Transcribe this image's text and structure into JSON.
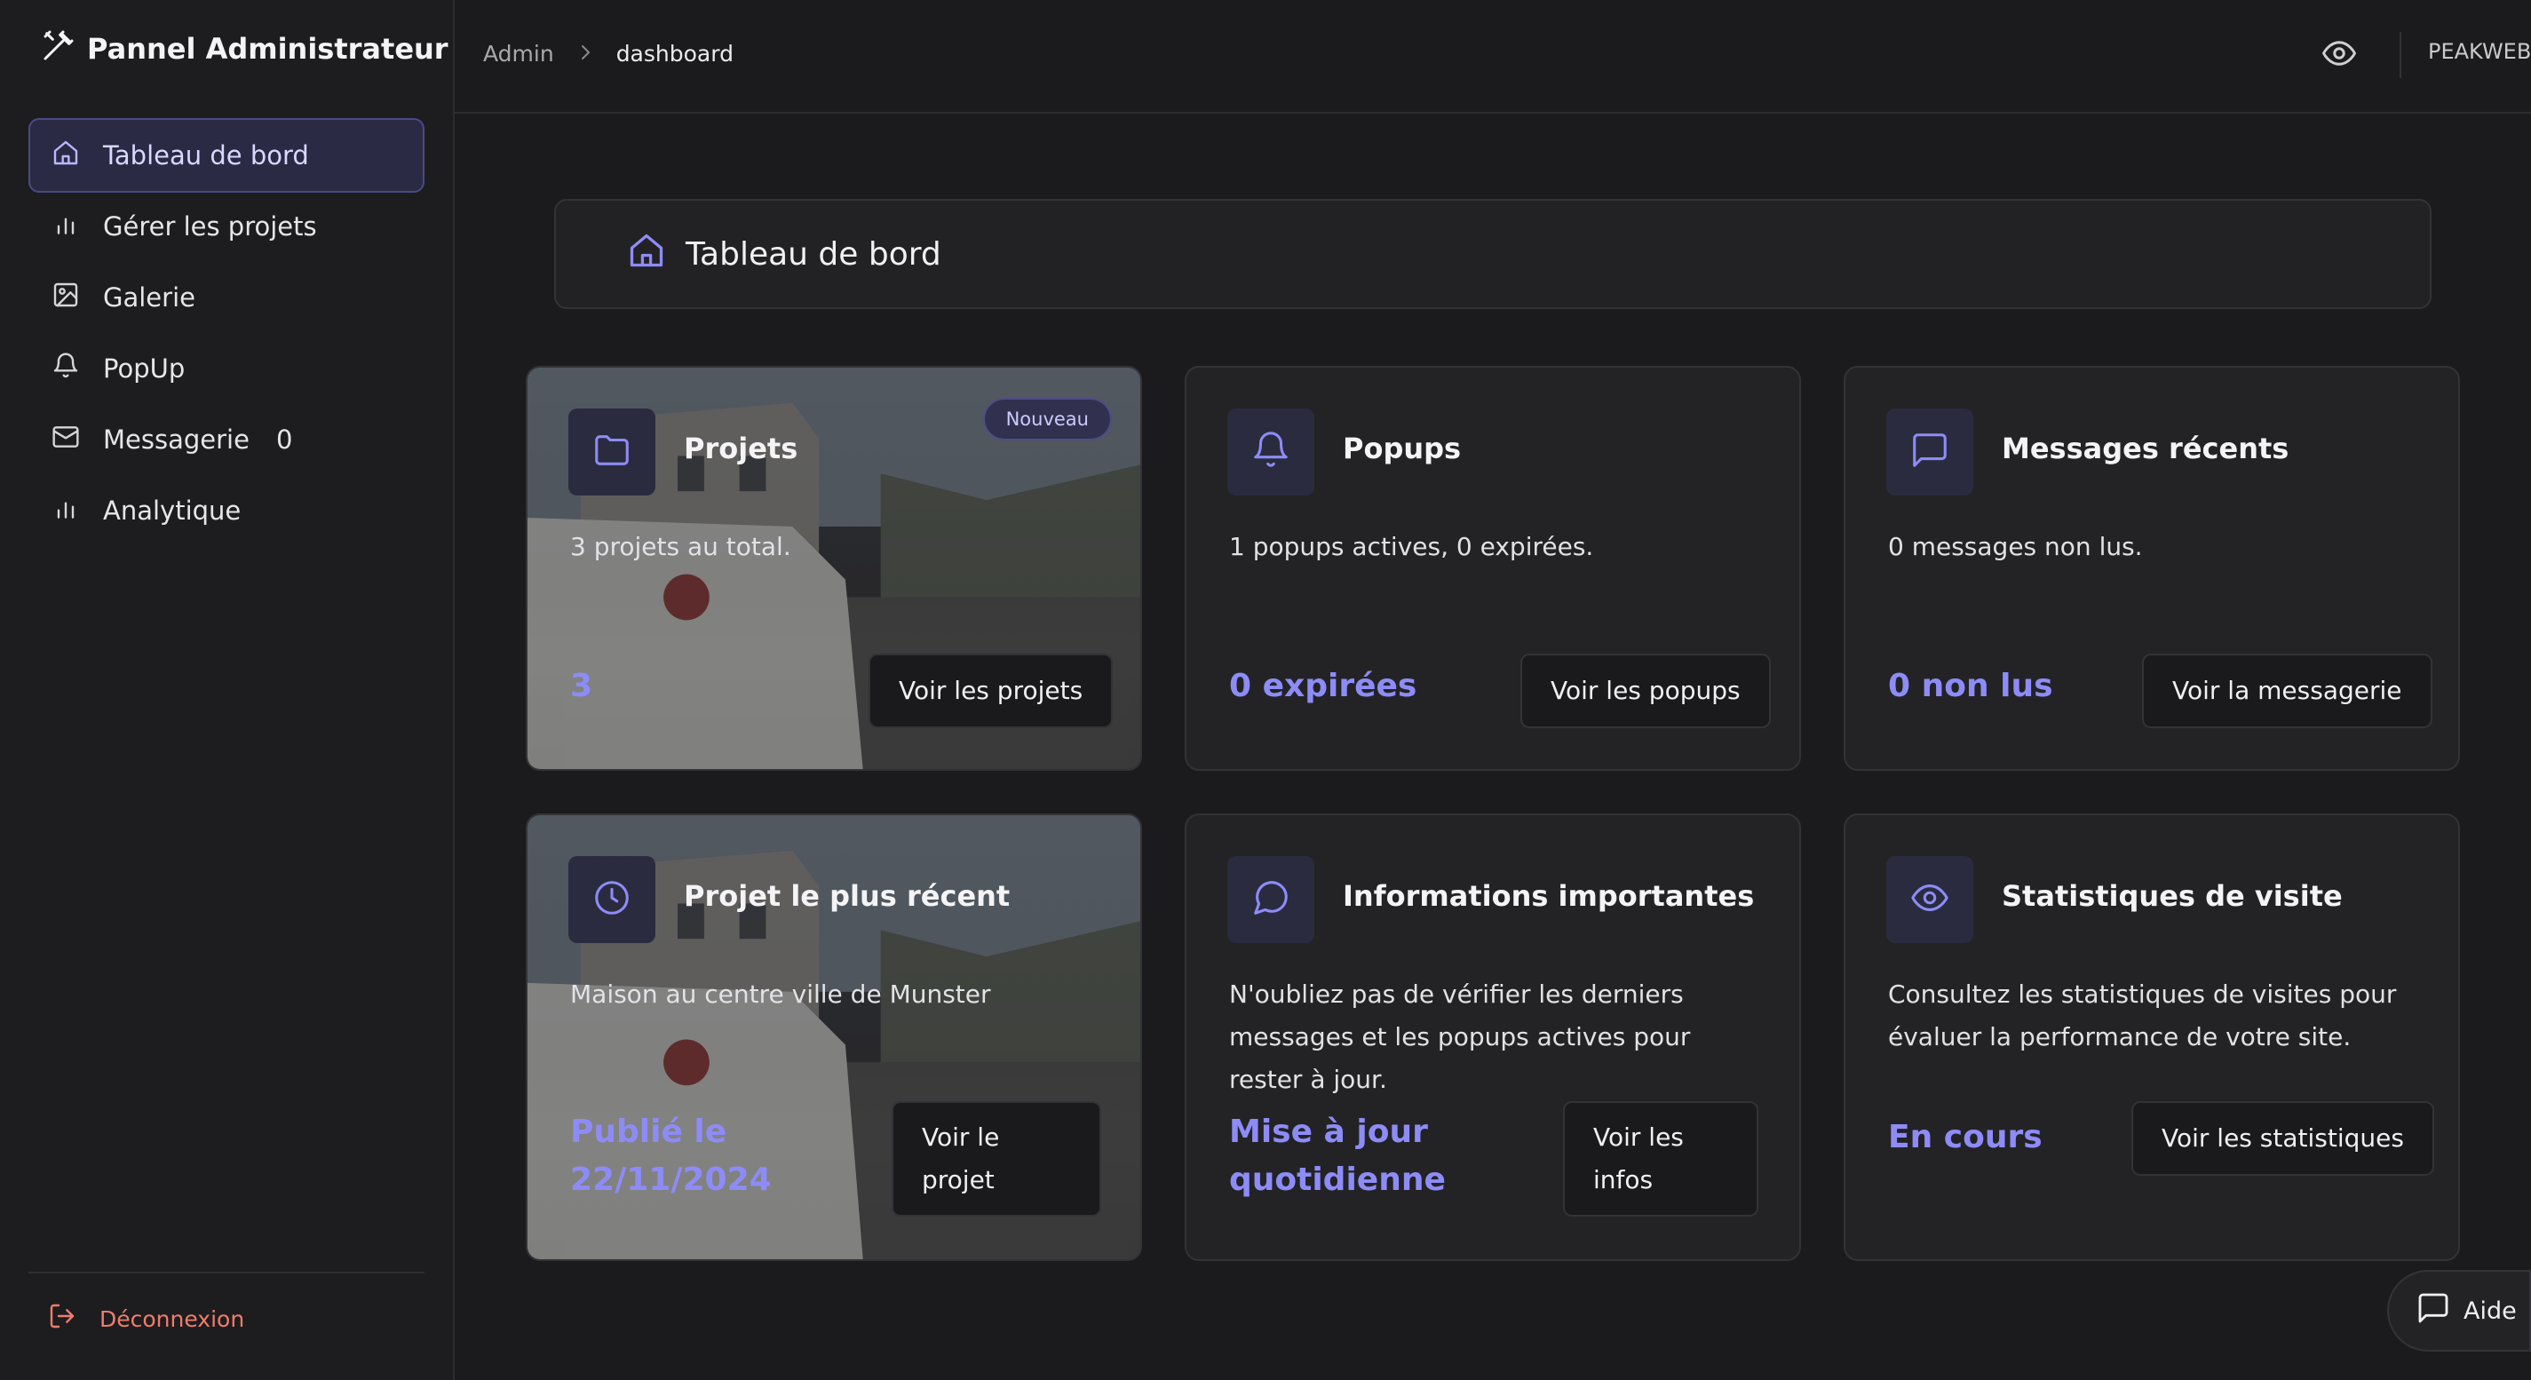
{
  "brand": {
    "title": "Pannel Administrateur",
    "icon": "hammer-wrench-icon"
  },
  "sidebar": {
    "items": [
      {
        "label": "Tableau de bord",
        "icon": "home-icon",
        "active": true
      },
      {
        "label": "Gérer les projets",
        "icon": "bar-chart-icon"
      },
      {
        "label": "Galerie",
        "icon": "image-icon"
      },
      {
        "label": "PopUp",
        "icon": "bell-icon"
      },
      {
        "label": "Messagerie",
        "icon": "mail-icon",
        "count": "0"
      },
      {
        "label": "Analytique",
        "icon": "bar-chart-icon"
      }
    ],
    "logout": "Déconnexion"
  },
  "topbar": {
    "breadcrumb": [
      "Admin",
      "dashboard"
    ],
    "separator": ">",
    "user": "PEAKWEB"
  },
  "header": {
    "title": "Tableau de bord"
  },
  "cards": [
    {
      "title": "Projets",
      "icon": "folder-icon",
      "badge": "Nouveau",
      "description": "3 projets au total.",
      "stat": "3",
      "button": "Voir les projets"
    },
    {
      "title": "Popups",
      "icon": "bell-icon",
      "description": "1 popups actives, 0 expirées.",
      "stat": "0 expirées",
      "button": "Voir les popups"
    },
    {
      "title": "Messages récents",
      "icon": "message-square-icon",
      "description": "0 messages non lus.",
      "stat": "0 non lus",
      "button": "Voir la messagerie"
    },
    {
      "title": "Projet le plus récent",
      "icon": "clock-icon",
      "description": "Maison au centre ville de Munster",
      "stat": "Publié le 22/11/2024",
      "button": "Voir le projet"
    },
    {
      "title": "Informations importantes",
      "icon": "message-circle-icon",
      "description": "N'oubliez pas de vérifier les derniers messages et les popups actives pour rester à jour.",
      "stat": "Mise à jour quotidienne",
      "button": "Voir les infos"
    },
    {
      "title": "Statistiques de visite",
      "icon": "eye-icon",
      "description": "Consultez les statistiques de visites pour évaluer la performance de votre site.",
      "stat": "En cours",
      "button": "Voir les statistiques"
    }
  ],
  "help": {
    "label": "Aide",
    "icon": "message-square-icon"
  },
  "colors": {
    "accent": "#8d8cf7",
    "active_bg": "#2b2a45",
    "danger": "#ef7d6c",
    "background": "#1b1b1d"
  }
}
